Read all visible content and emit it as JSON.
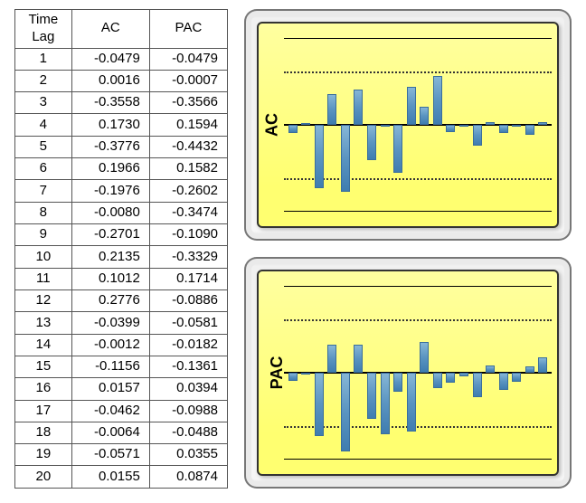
{
  "table": {
    "headers": {
      "lag": "Time\nLag",
      "ac": "AC",
      "pac": "PAC"
    },
    "rows": [
      {
        "lag": 1,
        "ac": "-0.0479",
        "pac": "-0.0479"
      },
      {
        "lag": 2,
        "ac": "0.0016",
        "pac": "-0.0007"
      },
      {
        "lag": 3,
        "ac": "-0.3558",
        "pac": "-0.3566"
      },
      {
        "lag": 4,
        "ac": "0.1730",
        "pac": "0.1594"
      },
      {
        "lag": 5,
        "ac": "-0.3776",
        "pac": "-0.4432"
      },
      {
        "lag": 6,
        "ac": "0.1966",
        "pac": "0.1582"
      },
      {
        "lag": 7,
        "ac": "-0.1976",
        "pac": "-0.2602"
      },
      {
        "lag": 8,
        "ac": "-0.0080",
        "pac": "-0.3474"
      },
      {
        "lag": 9,
        "ac": "-0.2701",
        "pac": "-0.1090"
      },
      {
        "lag": 10,
        "ac": "0.2135",
        "pac": "-0.3329"
      },
      {
        "lag": 11,
        "ac": "0.1012",
        "pac": "0.1714"
      },
      {
        "lag": 12,
        "ac": "0.2776",
        "pac": "-0.0886"
      },
      {
        "lag": 13,
        "ac": "-0.0399",
        "pac": "-0.0581"
      },
      {
        "lag": 14,
        "ac": "-0.0012",
        "pac": "-0.0182"
      },
      {
        "lag": 15,
        "ac": "-0.1156",
        "pac": "-0.1361"
      },
      {
        "lag": 16,
        "ac": "0.0157",
        "pac": "0.0394"
      },
      {
        "lag": 17,
        "ac": "-0.0462",
        "pac": "-0.0988"
      },
      {
        "lag": 18,
        "ac": "-0.0064",
        "pac": "-0.0488"
      },
      {
        "lag": 19,
        "ac": "-0.0571",
        "pac": "0.0355"
      },
      {
        "lag": 20,
        "ac": "0.0155",
        "pac": "0.0874"
      }
    ]
  },
  "chart_data": [
    {
      "type": "bar",
      "title": "",
      "ylabel": "AC",
      "xlabel": "",
      "ylim": [
        -0.5,
        0.5
      ],
      "confidence_bands": [
        -0.3,
        0.3
      ],
      "categories": [
        1,
        2,
        3,
        4,
        5,
        6,
        7,
        8,
        9,
        10,
        11,
        12,
        13,
        14,
        15,
        16,
        17,
        18,
        19,
        20
      ],
      "values": [
        -0.0479,
        0.0016,
        -0.3558,
        0.173,
        -0.3776,
        0.1966,
        -0.1976,
        -0.008,
        -0.2701,
        0.2135,
        0.1012,
        0.2776,
        -0.0399,
        -0.0012,
        -0.1156,
        0.0157,
        -0.0462,
        -0.0064,
        -0.0571,
        0.0155
      ]
    },
    {
      "type": "bar",
      "title": "",
      "ylabel": "PAC",
      "xlabel": "",
      "ylim": [
        -0.5,
        0.5
      ],
      "confidence_bands": [
        -0.3,
        0.3
      ],
      "categories": [
        1,
        2,
        3,
        4,
        5,
        6,
        7,
        8,
        9,
        10,
        11,
        12,
        13,
        14,
        15,
        16,
        17,
        18,
        19,
        20
      ],
      "values": [
        -0.0479,
        -0.0007,
        -0.3566,
        0.1594,
        -0.4432,
        0.1582,
        -0.2602,
        -0.3474,
        -0.109,
        -0.3329,
        0.1714,
        -0.0886,
        -0.0581,
        -0.0182,
        -0.1361,
        0.0394,
        -0.0988,
        -0.0488,
        0.0355,
        0.0874
      ]
    }
  ]
}
